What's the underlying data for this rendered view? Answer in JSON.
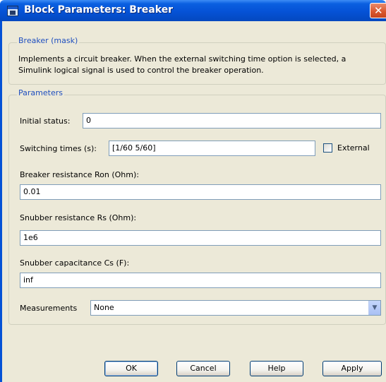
{
  "window": {
    "title": "Block Parameters: Breaker",
    "close_glyph": "✕"
  },
  "mask": {
    "group_label": "Breaker (mask)",
    "description": "Implements a circuit breaker. When the external switching time option is selected, a Simulink logical signal is used to control the breaker operation."
  },
  "parameters": {
    "group_label": "Parameters",
    "initial_status": {
      "label": "Initial status:",
      "value": "0"
    },
    "switching_times": {
      "label": "Switching times (s):",
      "value": "[1/60  5/60]"
    },
    "external": {
      "label": "External",
      "checked": false
    },
    "ron": {
      "label": "Breaker resistance Ron (Ohm):",
      "value": "0.01"
    },
    "rs": {
      "label": "Snubber resistance Rs (Ohm):",
      "value": "1e6"
    },
    "cs": {
      "label": "Snubber capacitance Cs (F):",
      "value": "inf"
    },
    "measurements": {
      "label": "Measurements",
      "value": "None"
    }
  },
  "buttons": {
    "ok": "OK",
    "cancel": "Cancel",
    "help": "Help",
    "apply": "Apply"
  },
  "icons": {
    "app": "simulink-block-icon",
    "close": "close-icon",
    "dropdown": "chevron-down-icon"
  }
}
